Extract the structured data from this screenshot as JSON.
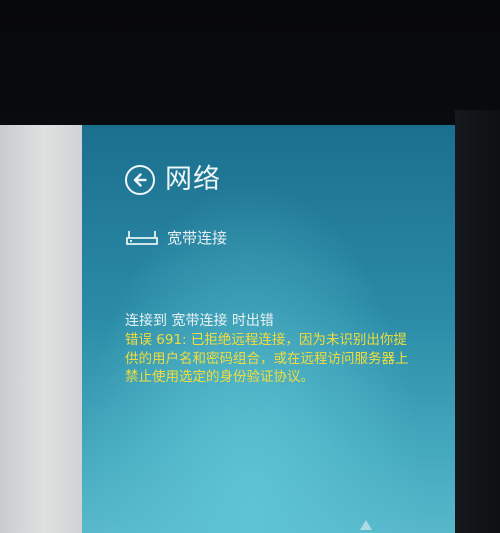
{
  "panel": {
    "title": "网络",
    "back_icon": "arrow-left-circle-icon"
  },
  "connection": {
    "icon": "broadband-modem-icon",
    "name": "宽带连接"
  },
  "error": {
    "heading": "连接到 宽带连接 时出错",
    "message": "错误 691: 已拒绝远程连接，因为未识别出你提供的用户名和密码组合，或在远程访问服务器上禁止使用选定的身份验证协议。"
  },
  "colors": {
    "panel_top": "#1b6f8e",
    "panel_bottom": "#57b8ca",
    "title_text": "#eef6f8",
    "error_text": "#f2dd3a"
  }
}
